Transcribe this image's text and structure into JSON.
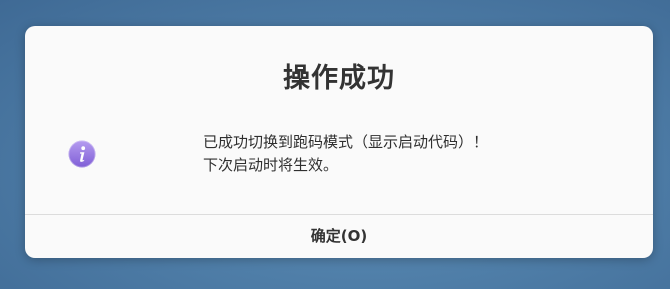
{
  "dialog": {
    "title": "操作成功",
    "message_line1": "已成功切换到跑码模式（显示启动代码）！",
    "message_line2": "下次启动时将生效。",
    "ok_label": "确定(O)",
    "icon": "info-icon"
  },
  "colors": {
    "icon_gradient_top": "#b59cf0",
    "icon_gradient_bottom": "#7f5ed6"
  }
}
